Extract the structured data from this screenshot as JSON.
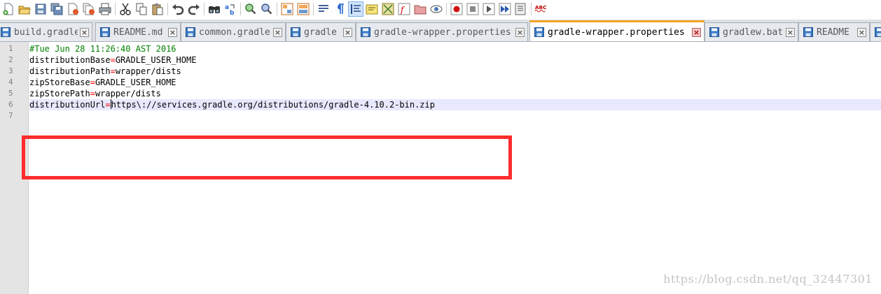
{
  "toolbar": {
    "buttons": [
      {
        "icon": "new-file-icon"
      },
      {
        "icon": "open-folder-icon"
      },
      {
        "icon": "save-icon"
      },
      {
        "icon": "save-all-icon"
      },
      {
        "icon": "close-file-icon"
      },
      {
        "icon": "close-all-icon"
      },
      {
        "icon": "print-icon"
      },
      {
        "icon": "cut-icon"
      },
      {
        "icon": "copy-icon"
      },
      {
        "icon": "paste-icon"
      },
      {
        "icon": "undo-icon"
      },
      {
        "icon": "redo-icon"
      },
      {
        "icon": "find-icon"
      },
      {
        "icon": "replace-icon"
      },
      {
        "icon": "zoom-in-icon"
      },
      {
        "icon": "zoom-out-icon"
      },
      {
        "icon": "sync-vertical-icon"
      },
      {
        "icon": "sync-horizontal-icon"
      },
      {
        "icon": "word-wrap-icon"
      },
      {
        "icon": "show-all-chars-icon"
      },
      {
        "icon": "indent-guide-icon"
      },
      {
        "icon": "language-icon"
      },
      {
        "icon": "doc-map-icon"
      },
      {
        "icon": "function-list-icon"
      },
      {
        "icon": "folder-workspace-icon"
      },
      {
        "icon": "monitor-icon"
      },
      {
        "icon": "record-macro-icon"
      },
      {
        "icon": "stop-record-icon"
      },
      {
        "icon": "play-macro-icon"
      },
      {
        "icon": "run-macro-multiple-icon"
      },
      {
        "icon": "save-macro-icon"
      },
      {
        "icon": "spell-check-icon"
      }
    ],
    "spellcheck_label": "ABC"
  },
  "tabs": [
    {
      "label": "build.gradle",
      "active": false
    },
    {
      "label": "README.md",
      "active": false
    },
    {
      "label": "common.gradle",
      "active": false
    },
    {
      "label": "gradle",
      "active": false
    },
    {
      "label": "gradle-wrapper.properties",
      "active": false
    },
    {
      "label": "gradle-wrapper.properties",
      "active": true
    },
    {
      "label": "gradlew.bat",
      "active": false
    },
    {
      "label": "README",
      "active": false
    },
    {
      "label": "",
      "active": false
    }
  ],
  "editor": {
    "lines": [
      {
        "number": "1",
        "comment": "#Tue Jun 28 11:26:40 AST 2016"
      },
      {
        "number": "2",
        "key": "distributionBase",
        "value": "GRADLE_USER_HOME"
      },
      {
        "number": "3",
        "key": "distributionPath",
        "value": "wrapper/dists"
      },
      {
        "number": "4",
        "key": "zipStoreBase",
        "value": "GRADLE_USER_HOME"
      },
      {
        "number": "5",
        "key": "zipStorePath",
        "value": "wrapper/dists"
      },
      {
        "number": "6",
        "key": "distributionUrl",
        "value": "https\\://services.gradle.org/distributions/gradle-4.10.2-bin.zip",
        "current": true
      },
      {
        "number": "7",
        "key": "",
        "value": ""
      }
    ],
    "equals": "="
  },
  "colors": {
    "comment": "#008000",
    "operator": "#ff0000",
    "current_line": "#e8e8ff",
    "active_tab_accent": "#f5a623",
    "annotation_box": "#ff2d2d"
  },
  "watermark": "https://blog.csdn.net/qq_32447301"
}
